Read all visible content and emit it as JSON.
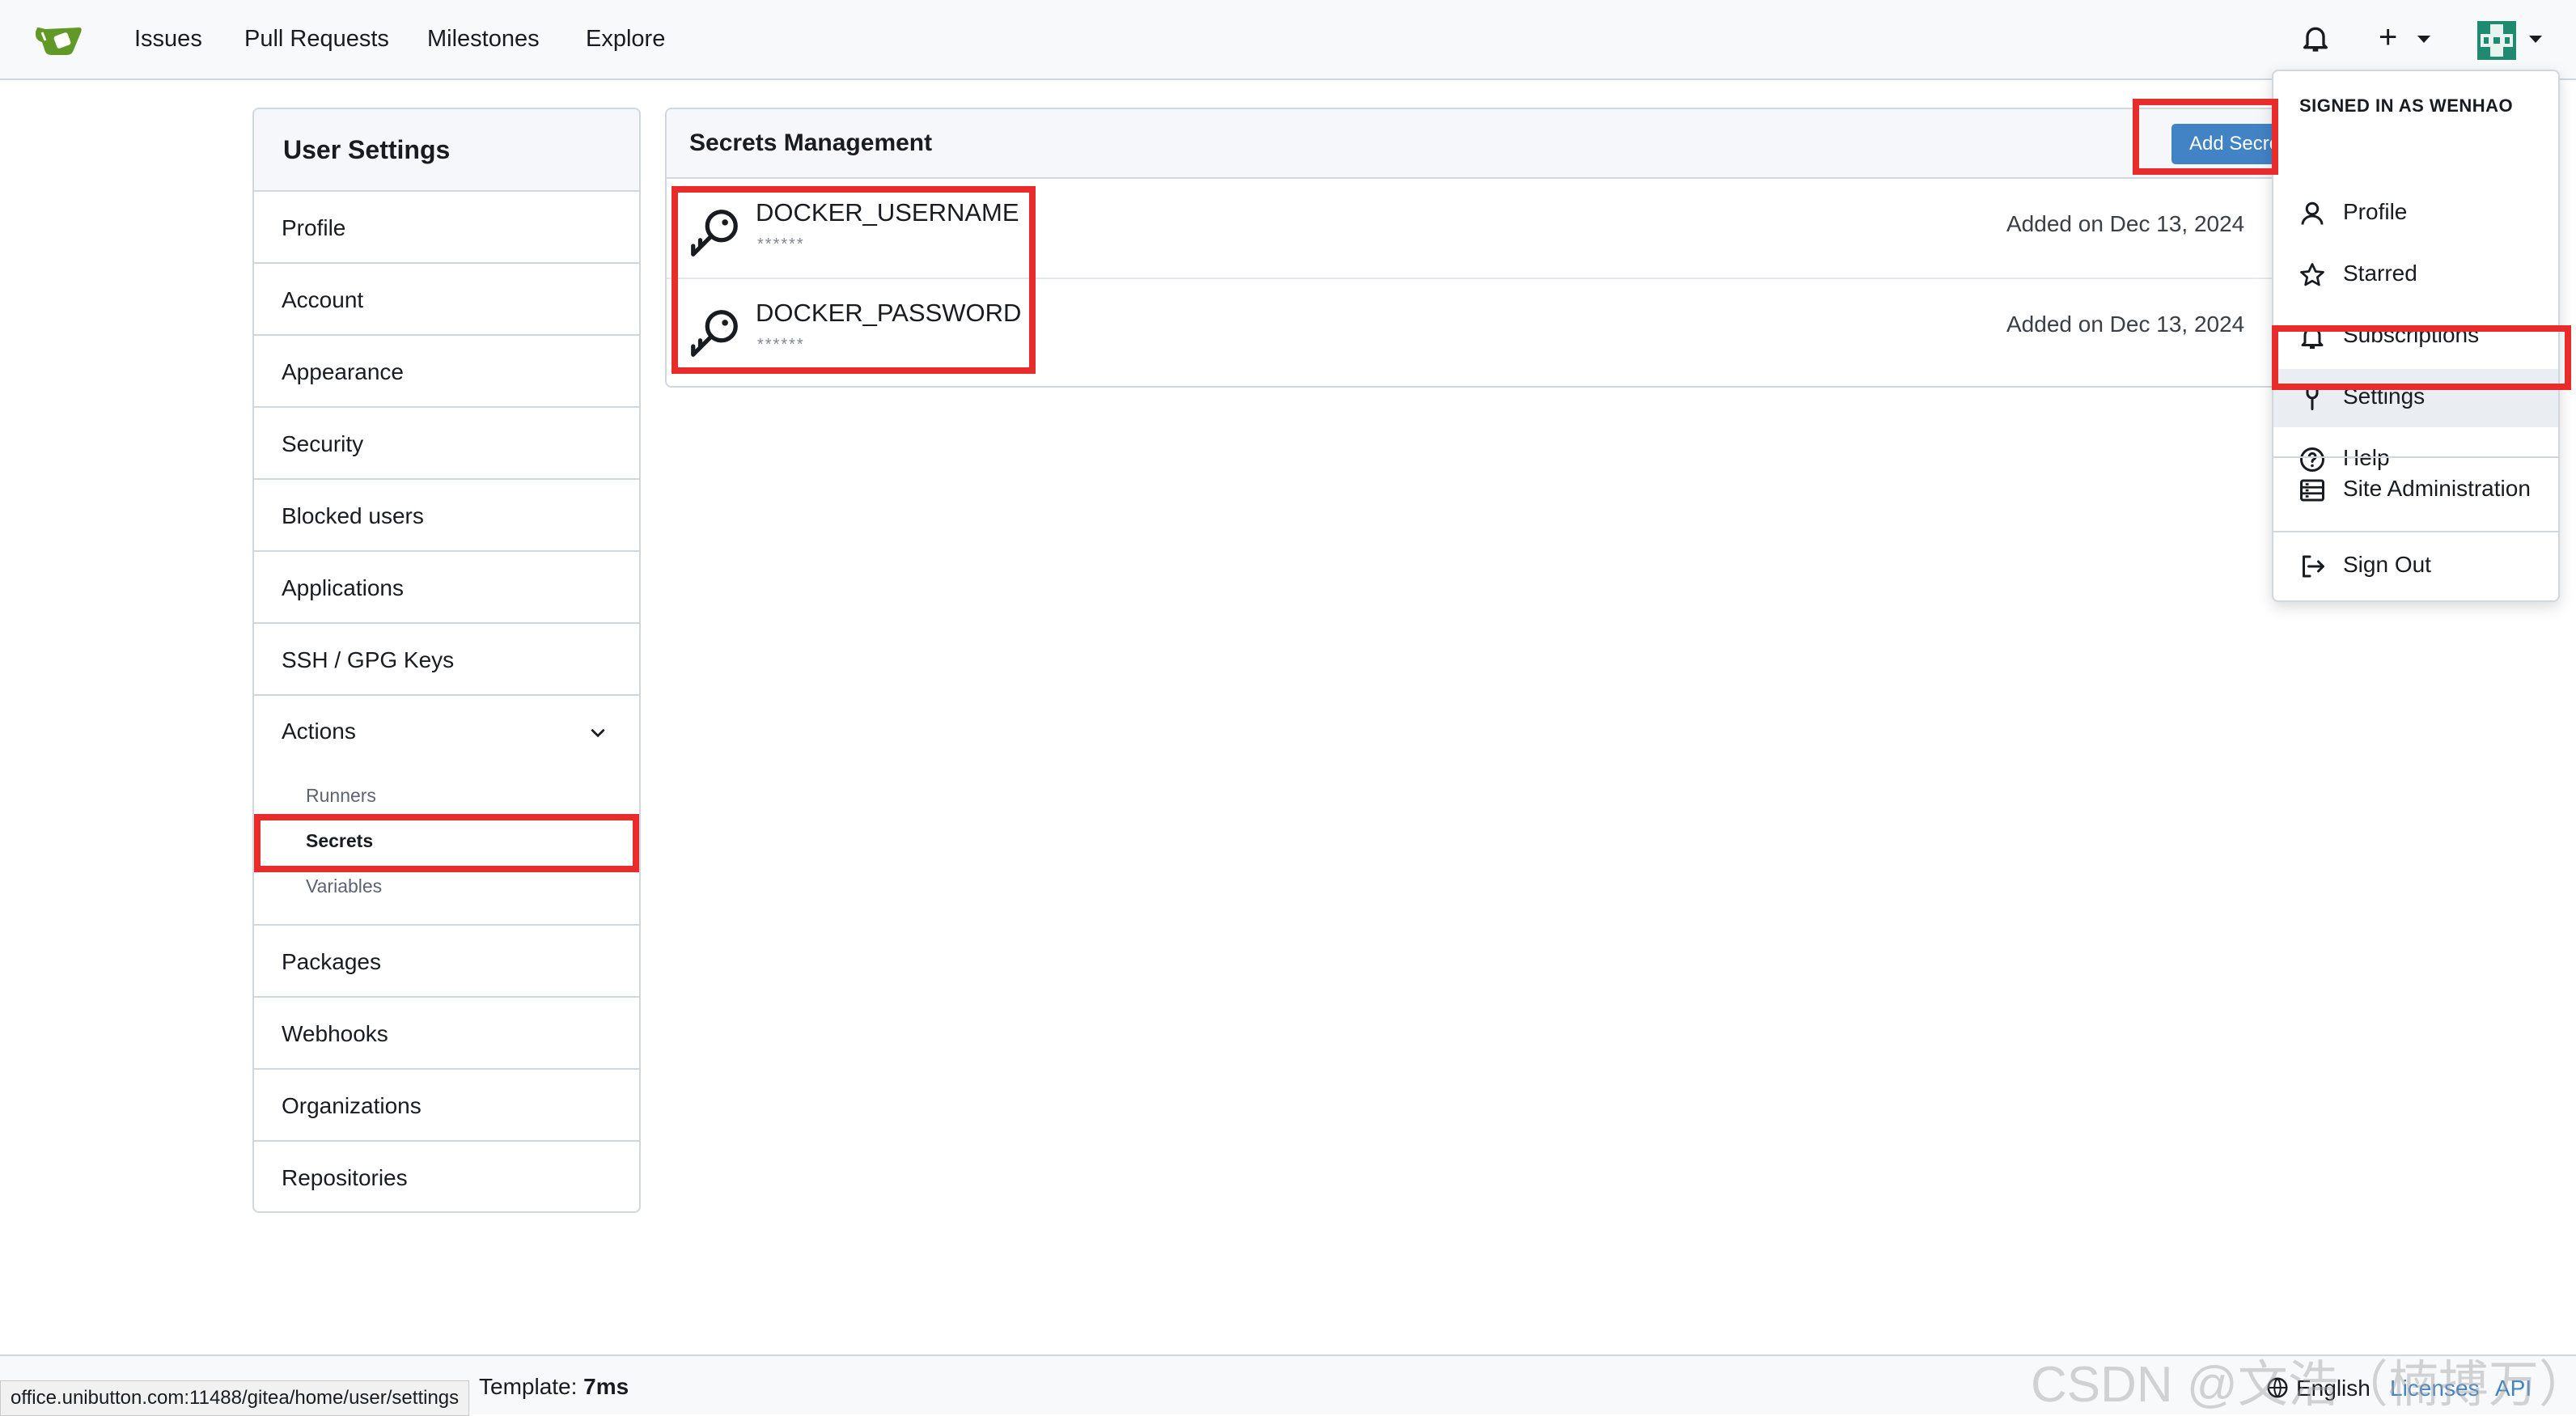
{
  "nav": {
    "links": [
      "Issues",
      "Pull Requests",
      "Milestones",
      "Explore"
    ]
  },
  "sidebar": {
    "title": "User Settings",
    "items_top": [
      "Profile",
      "Account",
      "Appearance",
      "Security",
      "Blocked users",
      "Applications",
      "SSH / GPG Keys"
    ],
    "actions": {
      "label": "Actions",
      "sub_items": [
        "Runners",
        "Secrets",
        "Variables"
      ],
      "active": "Secrets"
    },
    "items_bottom": [
      "Packages",
      "Webhooks",
      "Organizations",
      "Repositories"
    ]
  },
  "panel": {
    "title": "Secrets Management",
    "add_button": "Add Secret",
    "secrets": [
      {
        "name": "DOCKER_USERNAME",
        "value": "******",
        "added": "Added on Dec 13, 2024"
      },
      {
        "name": "DOCKER_PASSWORD",
        "value": "******",
        "added": "Added on Dec 13, 2024"
      }
    ]
  },
  "dropdown": {
    "header": "SIGNED IN AS WENHAO",
    "items": [
      {
        "label": "Profile",
        "icon": "person-icon"
      },
      {
        "label": "Starred",
        "icon": "star-icon"
      },
      {
        "label": "Subscriptions",
        "icon": "bell-icon"
      },
      {
        "label": "Settings",
        "icon": "tool-icon"
      },
      {
        "label": "Help",
        "icon": "question-icon"
      },
      {
        "label": "Site Administration",
        "icon": "server-icon"
      },
      {
        "label": "Sign Out",
        "icon": "sign-out-icon"
      }
    ]
  },
  "footer": {
    "url_tip": "office.unibutton.com:11488/gitea/home/user/settings",
    "template_label": "Template: ",
    "template_value": "7ms",
    "language": "English",
    "licenses": "Licenses",
    "api": "API",
    "watermark": "CSDN @文浩（楠搏万）"
  },
  "colors": {
    "accent": "#4183c4",
    "annotation": "#e82b2b",
    "logo_green": "#609926"
  }
}
